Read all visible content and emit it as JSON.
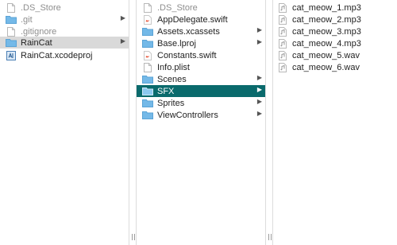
{
  "column1": {
    "items": [
      {
        "label": ".DS_Store",
        "icon": "document-icon",
        "dim": true,
        "chevron": false
      },
      {
        "label": ".git",
        "icon": "folder-icon",
        "dim": true,
        "chevron": true
      },
      {
        "label": ".gitignore",
        "icon": "document-icon",
        "dim": true,
        "chevron": false
      },
      {
        "label": "RainCat",
        "icon": "folder-icon",
        "dim": false,
        "chevron": true,
        "selected": "inactive"
      },
      {
        "label": "RainCat.xcodeproj",
        "icon": "xcodeproj-icon",
        "dim": false,
        "chevron": false
      }
    ]
  },
  "column2": {
    "items": [
      {
        "label": ".DS_Store",
        "icon": "document-icon",
        "dim": true,
        "chevron": false
      },
      {
        "label": "AppDelegate.swift",
        "icon": "swift-file-icon",
        "dim": false,
        "chevron": false
      },
      {
        "label": "Assets.xcassets",
        "icon": "folder-icon",
        "dim": false,
        "chevron": true
      },
      {
        "label": "Base.lproj",
        "icon": "folder-icon",
        "dim": false,
        "chevron": true
      },
      {
        "label": "Constants.swift",
        "icon": "swift-file-icon",
        "dim": false,
        "chevron": false
      },
      {
        "label": "Info.plist",
        "icon": "document-icon",
        "dim": false,
        "chevron": false
      },
      {
        "label": "Scenes",
        "icon": "folder-icon",
        "dim": false,
        "chevron": true
      },
      {
        "label": "SFX",
        "icon": "folder-icon",
        "dim": false,
        "chevron": true,
        "selected": "active"
      },
      {
        "label": "Sprites",
        "icon": "folder-icon",
        "dim": false,
        "chevron": true
      },
      {
        "label": "ViewControllers",
        "icon": "folder-icon",
        "dim": false,
        "chevron": true
      }
    ]
  },
  "column3": {
    "items": [
      {
        "label": "cat_meow_1.mp3",
        "icon": "audio-file-icon"
      },
      {
        "label": "cat_meow_2.mp3",
        "icon": "audio-file-icon"
      },
      {
        "label": "cat_meow_3.mp3",
        "icon": "audio-file-icon"
      },
      {
        "label": "cat_meow_4.mp3",
        "icon": "audio-file-icon"
      },
      {
        "label": "cat_meow_5.wav",
        "icon": "audio-file-icon"
      },
      {
        "label": "cat_meow_6.wav",
        "icon": "audio-file-icon"
      }
    ]
  },
  "colors": {
    "selected_active": "#0a6a6c",
    "selected_inactive": "#d9d9d9",
    "folder": "#74b9e8",
    "swift": "#e8553a",
    "dim_text": "#8e8e8e"
  }
}
